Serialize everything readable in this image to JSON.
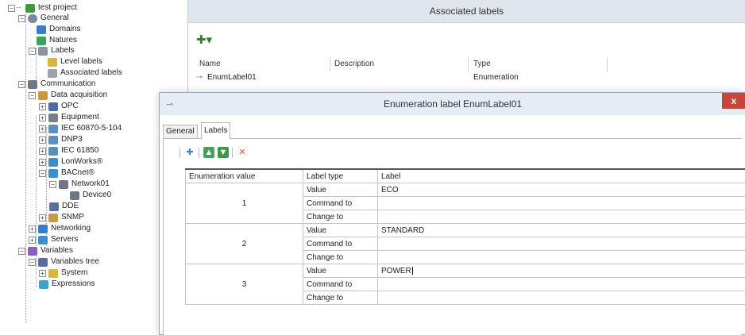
{
  "tree": {
    "items": [
      {
        "label": "test project",
        "icon": "project-icon",
        "color": "#3a9d3a"
      },
      {
        "label": "General",
        "icon": "general-gear-icon",
        "color": "#7a8aa0"
      },
      {
        "label": "Domains",
        "icon": "domains-icon",
        "color": "#3b7dc4"
      },
      {
        "label": "Natures",
        "icon": "natures-icon",
        "color": "#3aa55a"
      },
      {
        "label": "Labels",
        "icon": "labels-icon",
        "color": "#8a93a0"
      },
      {
        "label": "Level labels",
        "icon": "level-labels-icon",
        "color": "#d8b838"
      },
      {
        "label": "Associated labels",
        "icon": "associated-labels-icon",
        "color": "#9aa3ad"
      },
      {
        "label": "Communication",
        "icon": "communication-icon",
        "color": "#6f7784"
      },
      {
        "label": "Data acquisition",
        "icon": "data-acquisition-icon",
        "color": "#c89a3a"
      },
      {
        "label": "OPC",
        "icon": "opc-icon",
        "color": "#4a6fa8"
      },
      {
        "label": "Equipment",
        "icon": "equipment-icon",
        "color": "#7a7f87"
      },
      {
        "label": "IEC 60870-5-104",
        "icon": "iec-104-icon",
        "color": "#5a8fbf"
      },
      {
        "label": "DNP3",
        "icon": "dnp3-icon",
        "color": "#5a8fbf"
      },
      {
        "label": "IEC 61850",
        "icon": "iec-61850-icon",
        "color": "#5a8fbf"
      },
      {
        "label": "LonWorks®",
        "icon": "lonworks-icon",
        "color": "#3a8fd0"
      },
      {
        "label": "BACnet®",
        "icon": "bacnet-icon",
        "color": "#3a8fd0"
      },
      {
        "label": "Network01",
        "icon": "network-icon",
        "color": "#6f7784"
      },
      {
        "label": "Device0",
        "icon": "device-icon",
        "color": "#6f7784"
      },
      {
        "label": "DDE",
        "icon": "dde-icon",
        "color": "#5a6ea0"
      },
      {
        "label": "SNMP",
        "icon": "snmp-icon",
        "color": "#c79a3a"
      },
      {
        "label": "Networking",
        "icon": "networking-icon",
        "color": "#3a7fc4"
      },
      {
        "label": "Servers",
        "icon": "servers-icon",
        "color": "#3a8fd0"
      },
      {
        "label": "Variables",
        "icon": "variables-icon",
        "color": "#8a5fc0"
      },
      {
        "label": "Variables tree",
        "icon": "variables-tree-icon",
        "color": "#5a6ea0"
      },
      {
        "label": "System",
        "icon": "system-folder-icon",
        "color": "#d8b838"
      },
      {
        "label": "Expressions",
        "icon": "expressions-icon",
        "color": "#3aa5c8"
      }
    ]
  },
  "assoc": {
    "title": "Associated labels",
    "columns": {
      "name": "Name",
      "description": "Description",
      "type": "Type"
    },
    "rows": [
      {
        "name": "EnumLabel01",
        "description": "",
        "type": "Enumeration"
      }
    ]
  },
  "dialog": {
    "title": "Enumeration label EnumLabel01",
    "close": "x",
    "tabs": {
      "general": "General",
      "labels": "Labels"
    },
    "grid": {
      "headers": {
        "enum": "Enumeration value",
        "type": "Label type",
        "label": "Label"
      },
      "groups": [
        {
          "enum": "1",
          "value_type": "Value",
          "value": "ECO",
          "command_type": "Command to",
          "command": "",
          "change_type": "Change to",
          "change": ""
        },
        {
          "enum": "2",
          "value_type": "Value",
          "value": "STANDARD",
          "command_type": "Command to",
          "command": "",
          "change_type": "Change to",
          "change": ""
        },
        {
          "enum": "3",
          "value_type": "Value",
          "value": "POWER",
          "command_type": "Command to",
          "command": "",
          "change_type": "Change to",
          "change": ""
        }
      ]
    }
  }
}
